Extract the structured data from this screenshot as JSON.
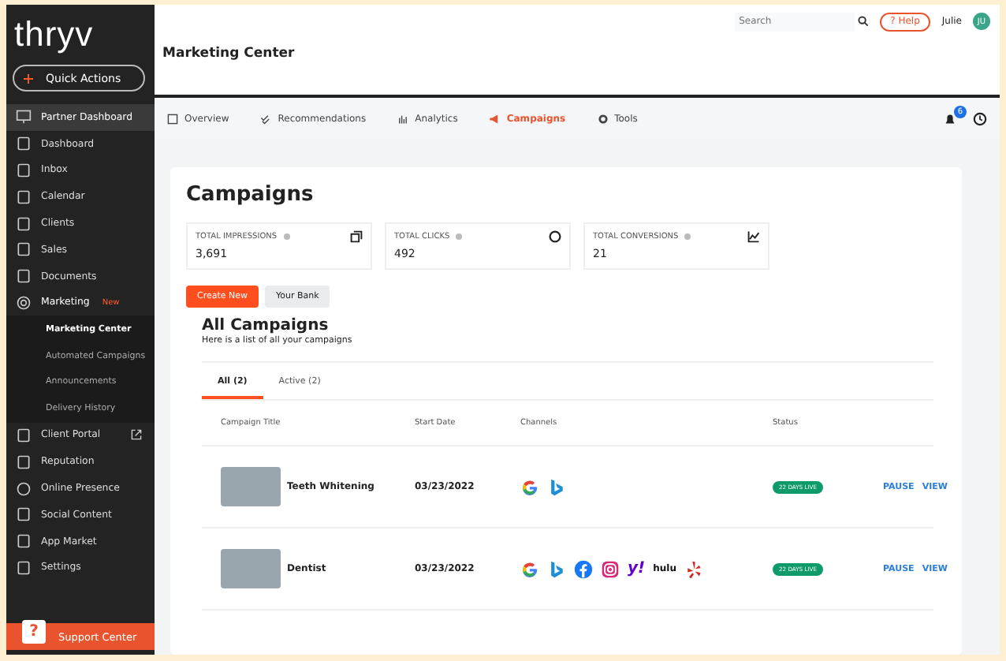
{
  "sidebar": {
    "logo": "thryv",
    "quick_action": "Quick Actions",
    "items": [
      {
        "label": "Partner Dashboard",
        "selected": true
      },
      {
        "label": "Dashboard",
        "selected": false
      },
      {
        "label": "Inbox",
        "selected": false
      },
      {
        "label": "Calendar",
        "selected": false
      },
      {
        "label": "Clients",
        "selected": false
      },
      {
        "label": "Sales",
        "selected": false
      },
      {
        "label": "Documents",
        "selected": false
      },
      {
        "label": "Marketing",
        "selected": false,
        "badge": "New",
        "expanded": true,
        "children": [
          {
            "label": "Marketing Center",
            "selected": true
          },
          {
            "label": "Automated Campaigns",
            "selected": false
          },
          {
            "label": "Announcements",
            "selected": false
          },
          {
            "label": "Delivery History",
            "selected": false
          }
        ]
      },
      {
        "label": "Client Portal",
        "selected": false,
        "external": true
      },
      {
        "label": "Reputation",
        "selected": false
      },
      {
        "label": "Online Presence",
        "selected": false
      },
      {
        "label": "Social Content",
        "selected": false
      },
      {
        "label": "App Market",
        "selected": false
      },
      {
        "label": "Settings",
        "selected": false
      }
    ],
    "support": {
      "icon_text": "?",
      "label": "Support Center"
    }
  },
  "header": {
    "search": {
      "placeholder": "Search"
    },
    "help": "? Help",
    "user": "Julie",
    "avatar": "JU",
    "title": "Marketing Center"
  },
  "tabs": [
    {
      "label": "Overview",
      "selected": false
    },
    {
      "label": "Recommendations",
      "selected": false
    },
    {
      "label": "Analytics",
      "selected": false
    },
    {
      "label": "Campaigns",
      "selected": true
    },
    {
      "label": "Tools",
      "selected": false
    }
  ],
  "notifications": "6",
  "page_title": "Campaigns",
  "stats": [
    {
      "label": "TOTAL IMPRESSIONS",
      "value": "3,691"
    },
    {
      "label": "TOTAL CLICKS",
      "value": "492"
    },
    {
      "label": "TOTAL CONVERSIONS",
      "value": "21"
    }
  ],
  "buttons": [
    {
      "label": "Create New",
      "kind": "primary"
    },
    {
      "label": "Your Bank",
      "kind": "secondary"
    }
  ],
  "list": {
    "title": "All Campaigns",
    "subtitle": "Here is a list of all your campaigns",
    "filters": [
      {
        "label": "All (2)",
        "selected": true
      },
      {
        "label": "Active (2)",
        "selected": false
      }
    ],
    "columns": [
      "Campaign Title",
      "Start Date",
      "Channels",
      "Status"
    ],
    "rows": [
      {
        "title": "Teeth Whitening",
        "start_date": "03/23/2022",
        "channels": [
          {
            "kind": "google"
          },
          {
            "kind": "bing"
          }
        ],
        "status": "22 DAYS LIVE",
        "actions": [
          "PAUSE",
          "VIEW"
        ]
      },
      {
        "title": "Dentist",
        "start_date": "03/23/2022",
        "channels": [
          {
            "kind": "google"
          },
          {
            "kind": "bing"
          },
          {
            "kind": "facebook"
          },
          {
            "kind": "instagram"
          },
          {
            "kind": "yahoo",
            "label": "y!"
          },
          {
            "kind": "hulu",
            "label": "hulu"
          },
          {
            "kind": "yelp"
          }
        ],
        "status": "22 DAYS LIVE",
        "actions": [
          "PAUSE",
          "VIEW"
        ]
      }
    ]
  }
}
